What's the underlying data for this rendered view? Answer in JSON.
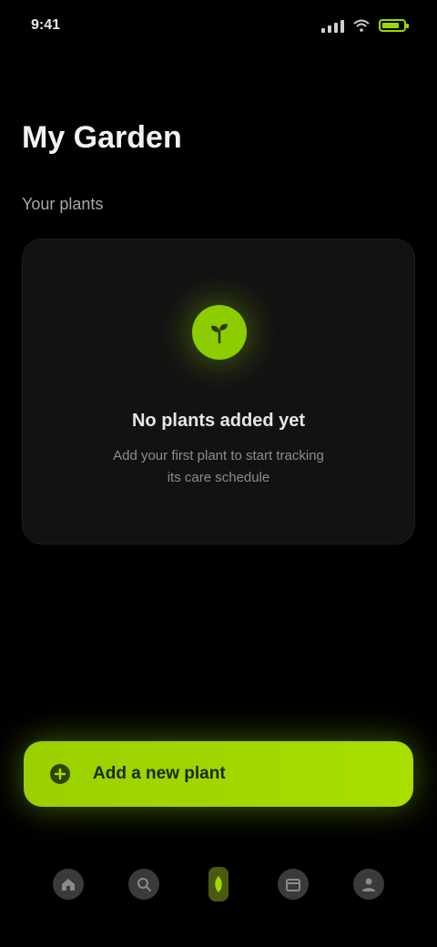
{
  "status_bar": {
    "time": "9:41",
    "battery_level": 0.8
  },
  "header": {
    "title": "My Garden",
    "subtitle": "Your plants"
  },
  "empty_state": {
    "badge_icon": "sprout-icon",
    "title": "No plants added yet",
    "body": "Add your first plant to start tracking its care schedule"
  },
  "cta": {
    "icon": "plus-icon",
    "label": "Add a new plant"
  },
  "tabs": [
    {
      "name": "home",
      "label": "",
      "icon": "home-icon",
      "active": false
    },
    {
      "name": "search",
      "label": "",
      "icon": "search-icon",
      "active": false
    },
    {
      "name": "garden",
      "label": "",
      "icon": "leaf-icon",
      "active": true
    },
    {
      "name": "calendar",
      "label": "",
      "icon": "calendar-icon",
      "active": false
    },
    {
      "name": "profile",
      "label": "",
      "icon": "user-icon",
      "active": false
    }
  ],
  "colors": {
    "accent": "#9fd800",
    "background": "#000000",
    "card": "#121212"
  }
}
